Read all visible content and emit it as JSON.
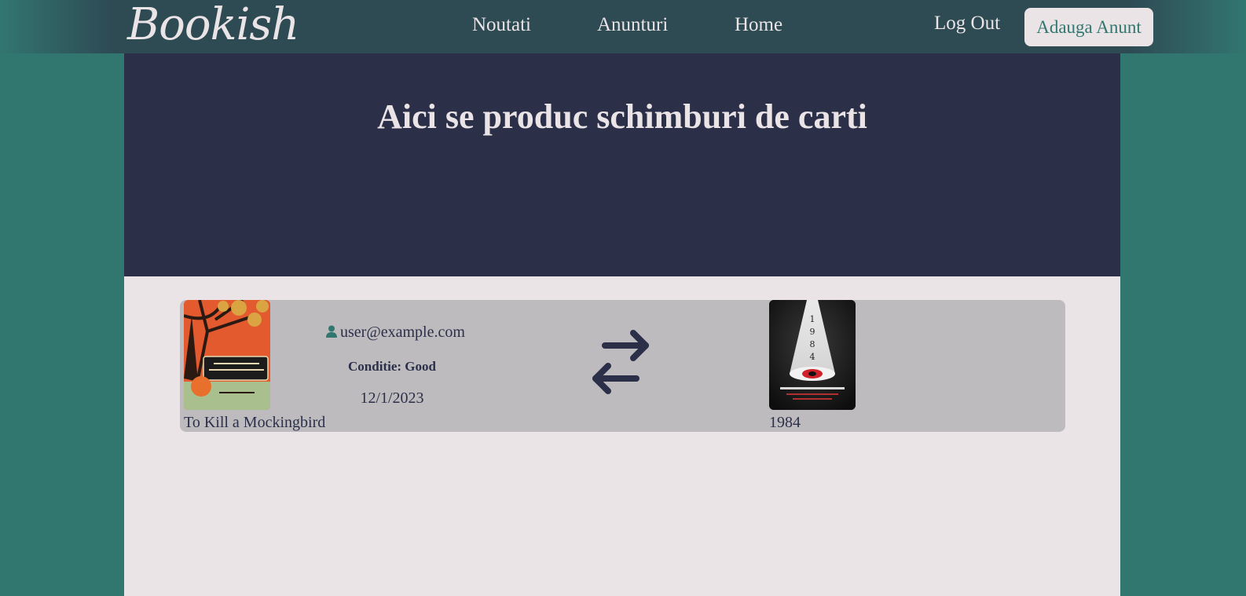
{
  "brand": {
    "logo": "Bookish"
  },
  "nav": {
    "noutati": "Noutati",
    "anunturi": "Anunturi",
    "home": "Home",
    "logout": "Log Out",
    "add_button": "Adauga Anunt"
  },
  "hero": {
    "title": "Aici se produc schimburi de carti"
  },
  "exchange": {
    "offered_book": {
      "title": "To Kill a Mockingbird"
    },
    "user_email": "user@example.com",
    "condition": "Conditie: Good",
    "date": "12/1/2023",
    "requested_book": {
      "title": "1984"
    }
  },
  "colors": {
    "background": "#327670",
    "navbar": "#2e4b54",
    "hero": "#2b2f48",
    "content": "#eae4e6",
    "card": "#bebbbf",
    "accent": "#327670"
  },
  "icons": {
    "user": "user-icon",
    "exchange": "exchange-arrows-icon"
  }
}
